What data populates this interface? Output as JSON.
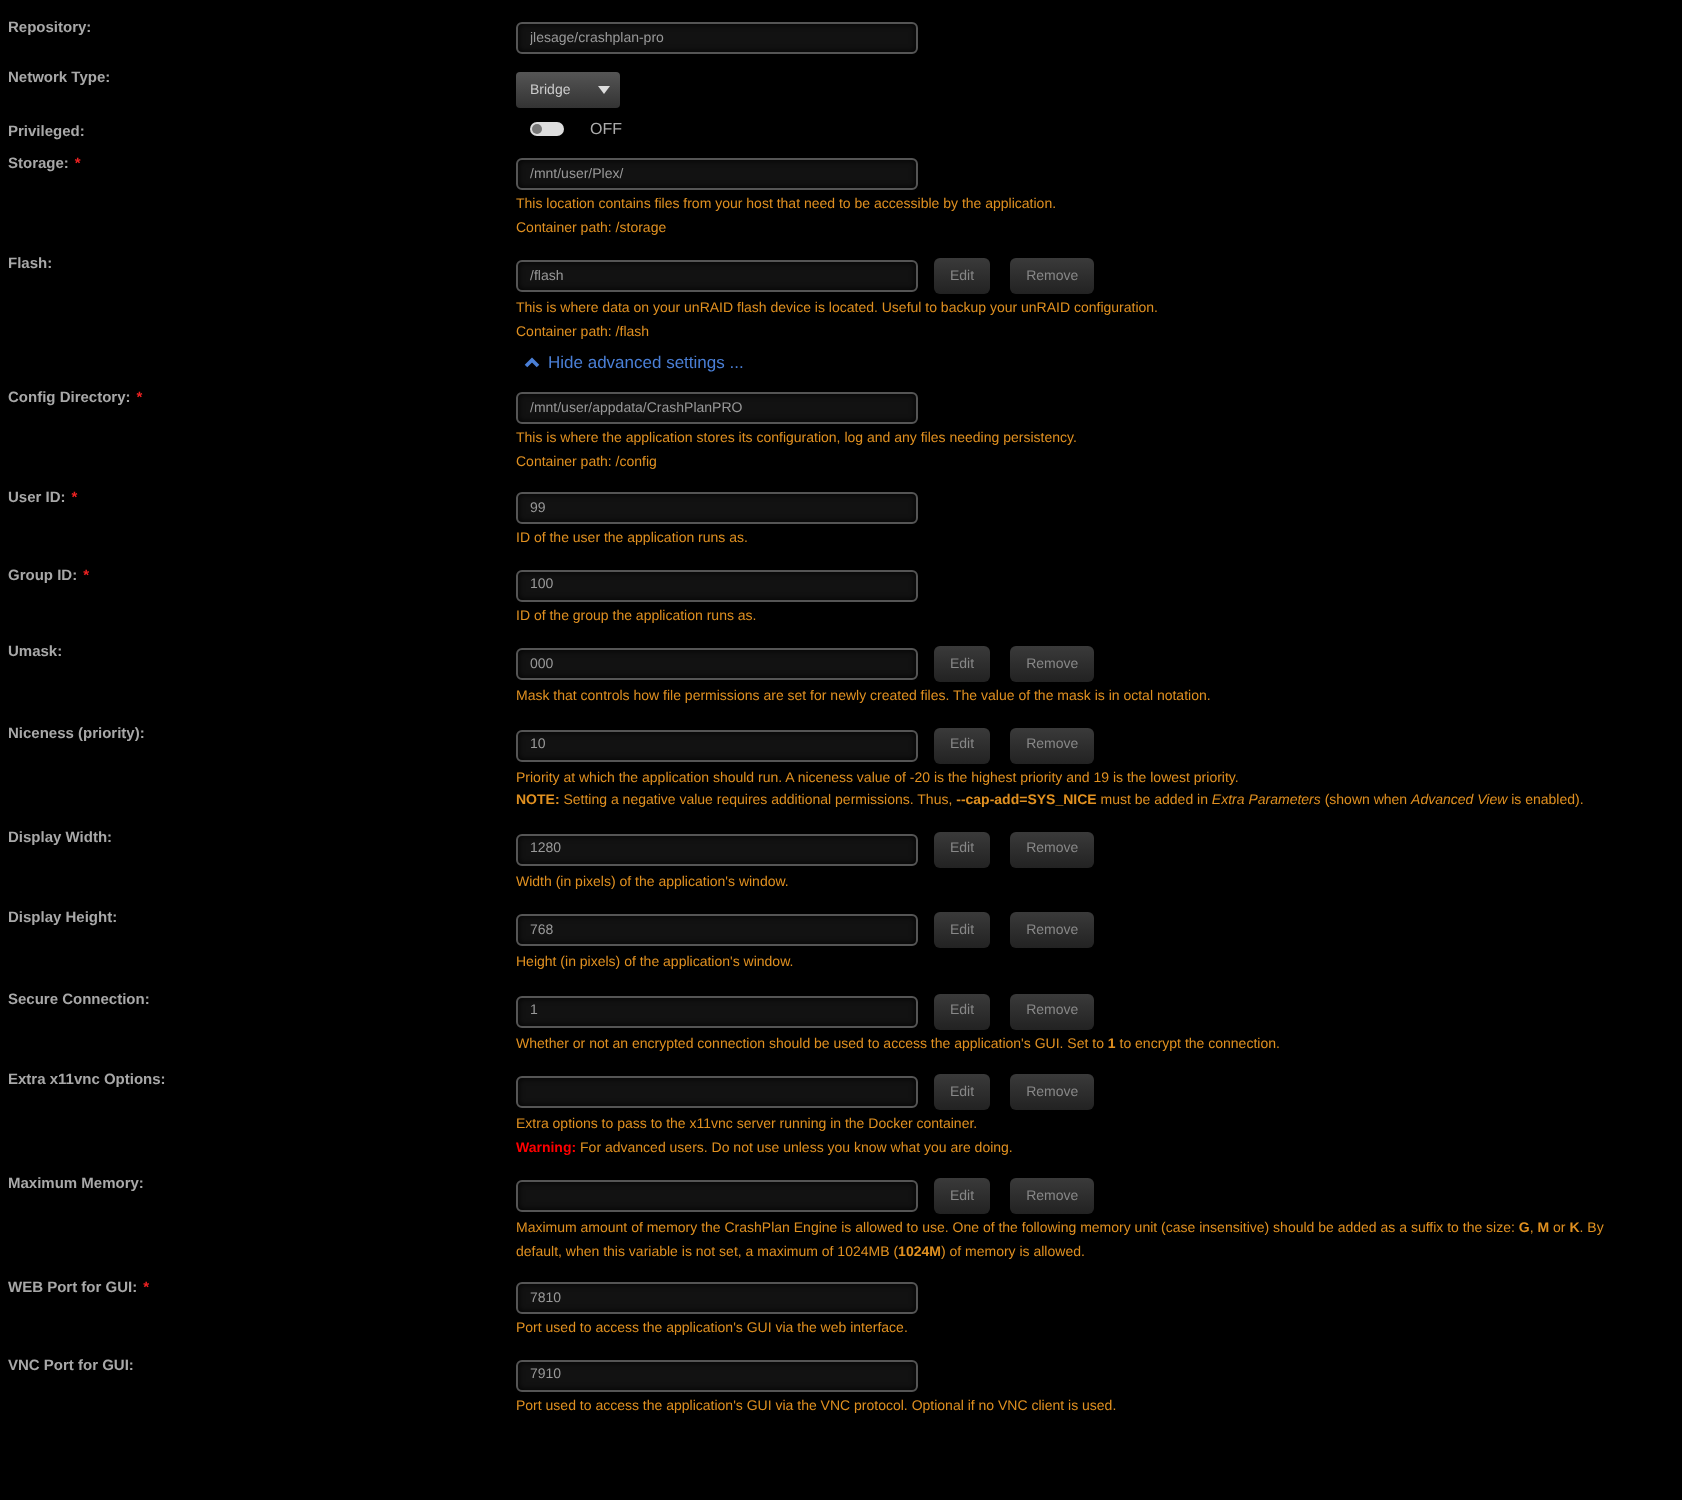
{
  "settings": [
    {
      "kind": "text",
      "label": "Repository:",
      "value": "jlesage/crashplan-pro"
    },
    {
      "kind": "select",
      "label": "Network Type:",
      "value": "Bridge"
    },
    {
      "kind": "toggle",
      "label": "Privileged:",
      "on": false,
      "value": "OFF"
    },
    {
      "kind": "text",
      "label": "Storage:",
      "required_mark": "*",
      "value": "/mnt/user/Plex/",
      "notes": [
        {
          "kind": "plain",
          "text": "This location contains files from your host that need to be accessible by the application."
        },
        {
          "kind": "plain",
          "text": "Container path: /storage"
        }
      ]
    },
    {
      "kind": "text",
      "label": "Flash:",
      "value": "/flash",
      "buttons": [
        "Edit",
        "Remove"
      ],
      "notes": [
        {
          "kind": "plain",
          "text": "This is where data on your unRAID flash device is located. Useful to backup your unRAID configuration."
        },
        {
          "kind": "plain",
          "text": "Container path: /flash"
        }
      ]
    },
    {
      "kind": "link",
      "text": "Hide advanced settings ...",
      "expanded": true
    },
    {
      "kind": "text",
      "label": "Config Directory:",
      "required_mark": "*",
      "value": "/mnt/user/appdata/CrashPlanPRO",
      "notes": [
        {
          "kind": "plain",
          "text": "This is where the application stores its configuration, log and any files needing persistency."
        },
        {
          "kind": "plain",
          "text": "Container path: /config"
        }
      ]
    },
    {
      "kind": "text",
      "label": "User ID:",
      "required_mark": "*",
      "value": "99",
      "notes": [
        {
          "kind": "plain",
          "text": "ID of the user the application runs as."
        }
      ]
    },
    {
      "kind": "text",
      "label": "Group ID:",
      "required_mark": "*",
      "value": "100",
      "notes": [
        {
          "kind": "plain",
          "text": "ID of the group the application runs as."
        }
      ]
    },
    {
      "kind": "text",
      "label": "Umask:",
      "value": "000",
      "buttons": [
        "Edit",
        "Remove"
      ],
      "notes": [
        {
          "kind": "plain",
          "text": "Mask that controls how file permissions are set for newly created files. The value of the mask is in octal notation."
        }
      ]
    },
    {
      "kind": "text",
      "label": "Niceness (priority):",
      "value": "10",
      "buttons": [
        "Edit",
        "Remove"
      ],
      "notes": [
        {
          "kind": "plain",
          "text": "Priority at which the application should run. A niceness value of -20 is the highest priority and 19 is the lowest priority."
        },
        {
          "kind": "plain",
          "text": "**NOTE:** Setting a negative value requires additional permissions. Thus, **--cap-add=SYS_NICE** must be added in *Extra Parameters* (shown when *Advanced View* is enabled)."
        }
      ]
    },
    {
      "kind": "text",
      "label": "Display Width:",
      "value": "1280",
      "buttons": [
        "Edit",
        "Remove"
      ],
      "notes": [
        {
          "kind": "plain",
          "text": "Width (in pixels) of the application's window."
        }
      ]
    },
    {
      "kind": "text",
      "label": "Display Height:",
      "value": "768",
      "buttons": [
        "Edit",
        "Remove"
      ],
      "notes": [
        {
          "kind": "plain",
          "text": "Height (in pixels) of the application's window."
        }
      ]
    },
    {
      "kind": "text",
      "label": "Secure Connection:",
      "value": "1",
      "buttons": [
        "Edit",
        "Remove"
      ],
      "notes": [
        {
          "kind": "plain",
          "text": "Whether or not an encrypted connection should be used to access the application's GUI. Set to **1** to encrypt the connection."
        }
      ]
    },
    {
      "kind": "text",
      "label": "Extra x11vnc Options:",
      "buttons": [
        "Edit",
        "Remove"
      ],
      "notes": [
        {
          "kind": "plain",
          "text": "Extra options to pass to the x11vnc server running in the Docker container."
        },
        {
          "kind": "warning",
          "label": "Warning:",
          "text": "For advanced users. Do not use unless you know what you are doing."
        }
      ]
    },
    {
      "kind": "text",
      "label": "Maximum Memory:",
      "buttons": [
        "Edit",
        "Remove"
      ],
      "notes": [
        {
          "kind": "plain",
          "text": "Maximum amount of memory the CrashPlan Engine is allowed to use. One of the following memory unit (case insensitive) should be added as a suffix to the size: **G**, **M** or **K**. By default, when this variable is not set, a maximum of 1024MB (**1024M**) of memory is allowed."
        }
      ]
    },
    {
      "kind": "text",
      "label": "WEB Port for GUI:",
      "required_mark": "*",
      "value": "7810",
      "notes": [
        {
          "kind": "plain",
          "text": "Port used to access the application's GUI via the web interface."
        }
      ]
    },
    {
      "kind": "text",
      "label": "VNC Port for GUI:",
      "value": "7910",
      "notes": [
        {
          "kind": "plain",
          "text": "Port used to access the application's GUI via the VNC protocol. Optional if no VNC client is used."
        }
      ]
    }
  ]
}
